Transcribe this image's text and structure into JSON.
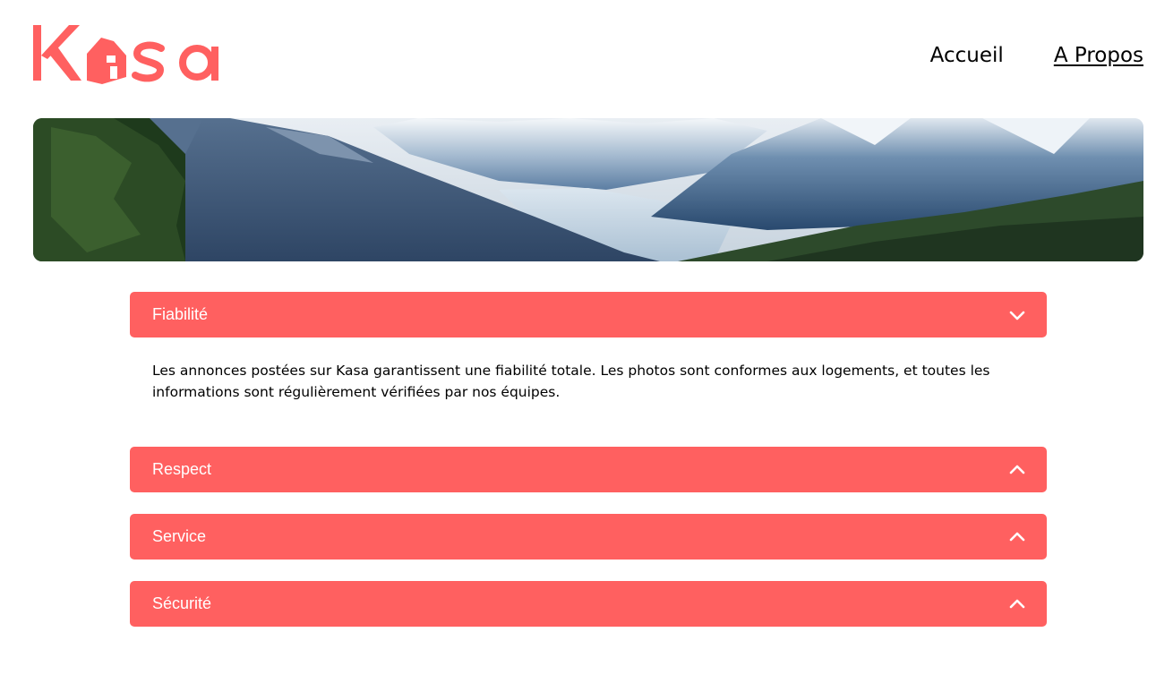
{
  "header": {
    "logo_text": "Kasa",
    "nav": [
      {
        "label": "Accueil",
        "active": false
      },
      {
        "label": "A Propos",
        "active": true
      }
    ]
  },
  "colors": {
    "brand": "#ff6060",
    "text": "#000000",
    "bar_text": "#ffffff"
  },
  "banner": {
    "icon": "mountain-landscape-image"
  },
  "accordions": [
    {
      "title": "Fiabilité",
      "open": true,
      "icon": "chevron-down-icon",
      "content": "Les annonces postées sur Kasa garantissent une fiabilité totale. Les photos sont conformes aux logements, et toutes les informations sont régulièrement vérifiées par nos équipes."
    },
    {
      "title": "Respect",
      "open": false,
      "icon": "chevron-up-icon"
    },
    {
      "title": "Service",
      "open": false,
      "icon": "chevron-up-icon"
    },
    {
      "title": "Sécurité",
      "open": false,
      "icon": "chevron-up-icon"
    }
  ]
}
